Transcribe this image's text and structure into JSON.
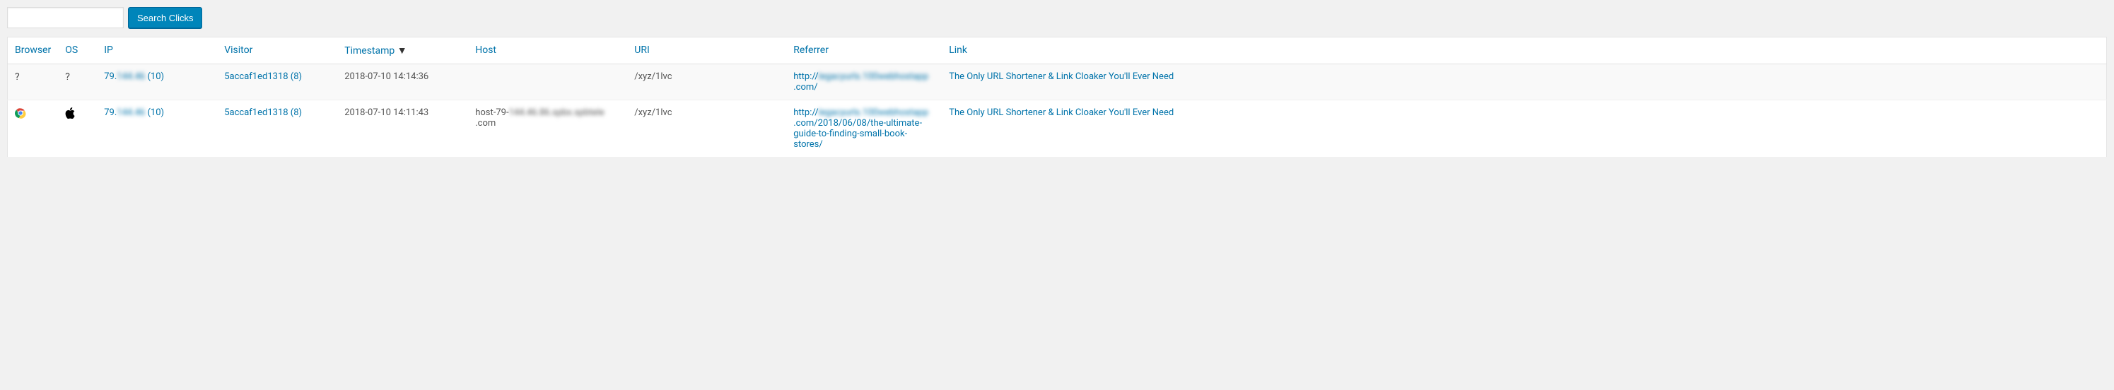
{
  "search": {
    "placeholder": "",
    "button_label": "Search Clicks"
  },
  "columns": {
    "browser": "Browser",
    "os": "OS",
    "ip": "IP",
    "visitor": "Visitor",
    "timestamp": "Timestamp",
    "host": "Host",
    "uri": "URI",
    "referrer": "Referrer",
    "link": "Link"
  },
  "sort_indicator": "▼",
  "rows": [
    {
      "browser_icon": "unknown",
      "os_icon": "unknown",
      "ip_prefix": "79.",
      "ip_hidden": "144.46",
      "ip_suffix": " (10)",
      "visitor": "5accaf1ed1318 (8)",
      "timestamp": "2018-07-10 14:14:36",
      "host_prefix": "",
      "host_hidden": "",
      "host_suffix": "",
      "uri": "/xyz/1lvc",
      "ref_pre": "http://",
      "ref_hidden": "legacyurls.100webhostapp",
      "ref_post": ".com/",
      "link": "The Only URL Shortener & Link Cloaker You'll Ever Need"
    },
    {
      "browser_icon": "chrome",
      "os_icon": "apple",
      "ip_prefix": "79.",
      "ip_hidden": "144.46",
      "ip_suffix": " (10)",
      "visitor": "5accaf1ed1318 (8)",
      "timestamp": "2018-07-10 14:11:43",
      "host_prefix": "host-79-",
      "host_hidden": "144.46.86.spbx.spbtele",
      "host_suffix": ".com",
      "uri": "/xyz/1lvc",
      "ref_pre": "http://",
      "ref_hidden": "legacyurls.100webhostapp",
      "ref_post": ".com/2018/06/08/the-ultimate-guide-to-finding-small-book-stores/",
      "link": "The Only URL Shortener & Link Cloaker You'll Ever Need"
    }
  ]
}
